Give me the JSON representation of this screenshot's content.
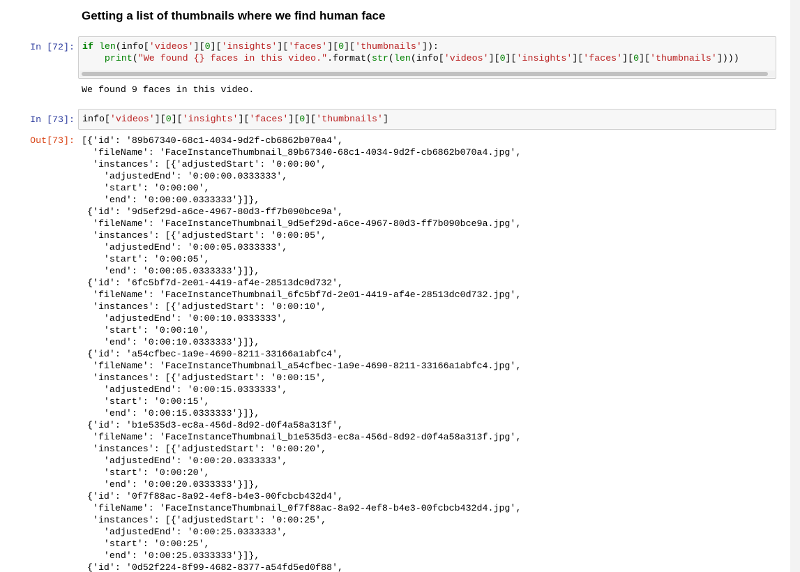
{
  "markdown": {
    "heading": "Getting a list of thumbnails where we find human face"
  },
  "cell72": {
    "prompt": "In [72]:",
    "line1": {
      "kw": "if",
      "fn": "len",
      "a": "(info[",
      "s1": "'videos'",
      "b": "][",
      "n1": "0",
      "c": "][",
      "s2": "'insights'",
      "d": "][",
      "s3": "'faces'",
      "e": "][",
      "n2": "0",
      "f": "][",
      "s4": "'thumbnails'",
      "g": "]):"
    },
    "line2": {
      "indent": "    ",
      "fn": "print",
      "a": "(",
      "s1": "\"We found {} faces in this video.\"",
      "b": ".format(",
      "fn2": "str",
      "c": "(",
      "fn3": "len",
      "d": "(info[",
      "s2": "'videos'",
      "e": "][",
      "n1": "0",
      "f": "][",
      "s3": "'insights'",
      "g": "][",
      "s4": "'faces'",
      "h": "][",
      "n2": "0",
      "i": "][",
      "s5": "'thumbnails'",
      "j": "])))"
    },
    "output": "We found 9 faces in this video."
  },
  "cell73": {
    "in_prompt": "In [73]:",
    "out_prompt": "Out[73]:",
    "input": {
      "a": "info[",
      "s1": "'videos'",
      "b": "][",
      "n1": "0",
      "c": "][",
      "s2": "'insights'",
      "d": "][",
      "s3": "'faces'",
      "e": "][",
      "n2": "0",
      "f": "][",
      "s4": "'thumbnails'",
      "g": "]"
    },
    "output": [
      "[{'id': '89b67340-68c1-4034-9d2f-cb6862b070a4',",
      "  'fileName': 'FaceInstanceThumbnail_89b67340-68c1-4034-9d2f-cb6862b070a4.jpg',",
      "  'instances': [{'adjustedStart': '0:00:00',",
      "    'adjustedEnd': '0:00:00.0333333',",
      "    'start': '0:00:00',",
      "    'end': '0:00:00.0333333'}]},",
      " {'id': '9d5ef29d-a6ce-4967-80d3-ff7b090bce9a',",
      "  'fileName': 'FaceInstanceThumbnail_9d5ef29d-a6ce-4967-80d3-ff7b090bce9a.jpg',",
      "  'instances': [{'adjustedStart': '0:00:05',",
      "    'adjustedEnd': '0:00:05.0333333',",
      "    'start': '0:00:05',",
      "    'end': '0:00:05.0333333'}]},",
      " {'id': '6fc5bf7d-2e01-4419-af4e-28513dc0d732',",
      "  'fileName': 'FaceInstanceThumbnail_6fc5bf7d-2e01-4419-af4e-28513dc0d732.jpg',",
      "  'instances': [{'adjustedStart': '0:00:10',",
      "    'adjustedEnd': '0:00:10.0333333',",
      "    'start': '0:00:10',",
      "    'end': '0:00:10.0333333'}]},",
      " {'id': 'a54cfbec-1a9e-4690-8211-33166a1abfc4',",
      "  'fileName': 'FaceInstanceThumbnail_a54cfbec-1a9e-4690-8211-33166a1abfc4.jpg',",
      "  'instances': [{'adjustedStart': '0:00:15',",
      "    'adjustedEnd': '0:00:15.0333333',",
      "    'start': '0:00:15',",
      "    'end': '0:00:15.0333333'}]},",
      " {'id': 'b1e535d3-ec8a-456d-8d92-d0f4a58a313f',",
      "  'fileName': 'FaceInstanceThumbnail_b1e535d3-ec8a-456d-8d92-d0f4a58a313f.jpg',",
      "  'instances': [{'adjustedStart': '0:00:20',",
      "    'adjustedEnd': '0:00:20.0333333',",
      "    'start': '0:00:20',",
      "    'end': '0:00:20.0333333'}]},",
      " {'id': '0f7f88ac-8a92-4ef8-b4e3-00fcbcb432d4',",
      "  'fileName': 'FaceInstanceThumbnail_0f7f88ac-8a92-4ef8-b4e3-00fcbcb432d4.jpg',",
      "  'instances': [{'adjustedStart': '0:00:25',",
      "    'adjustedEnd': '0:00:25.0333333',",
      "    'start': '0:00:25',",
      "    'end': '0:00:25.0333333'}]},",
      " {'id': '0d52f224-8f99-4682-8377-a54fd5ed0f88',"
    ]
  }
}
